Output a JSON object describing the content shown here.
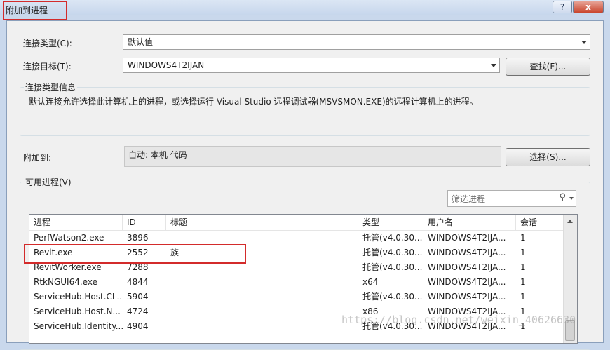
{
  "window": {
    "title": "附加到进程",
    "help_label": "?",
    "close_label": "x"
  },
  "connection": {
    "type_label": "连接类型(C):",
    "type_value": "默认值",
    "target_label": "连接目标(T):",
    "target_value": "WINDOWS4T2IJAN",
    "find_button": "查找(F)..."
  },
  "info": {
    "group_title": "连接类型信息",
    "text": "默认连接允许选择此计算机上的进程，或选择运行 Visual Studio 远程调试器(MSVSMON.EXE)的远程计算机上的进程。"
  },
  "attach": {
    "label": "附加到:",
    "value": "自动: 本机 代码",
    "select_button": "选择(S)..."
  },
  "processes": {
    "group_title": "可用进程(V)",
    "filter_placeholder": "筛选进程",
    "columns": [
      "进程",
      "ID",
      "标题",
      "类型",
      "用户名",
      "会话"
    ],
    "rows": [
      [
        "PerfWatson2.exe",
        "3896",
        "",
        "托管(v4.0.30...",
        "WINDOWS4T2IJA...",
        "1"
      ],
      [
        "Revit.exe",
        "2552",
        "族",
        "托管(v4.0.30...",
        "WINDOWS4T2IJA...",
        "1"
      ],
      [
        "RevitWorker.exe",
        "7288",
        "",
        "托管(v4.0.30...",
        "WINDOWS4T2IJA...",
        "1"
      ],
      [
        "RtkNGUI64.exe",
        "4844",
        "",
        "x64",
        "WINDOWS4T2IJA...",
        "1"
      ],
      [
        "ServiceHub.Host.CL...",
        "5904",
        "",
        "托管(v4.0.30...",
        "WINDOWS4T2IJA...",
        "1"
      ],
      [
        "ServiceHub.Host.N...",
        "4724",
        "",
        "x86",
        "WINDOWS4T2IJA...",
        "1"
      ],
      [
        "ServiceHub.Identity...",
        "4904",
        "",
        "托管(v4.0.30...",
        "WINDOWS4T2IJA...",
        "1"
      ]
    ]
  },
  "watermark": "https://blog.csdn.net/weixin_40626630",
  "colors": {
    "highlight_box": "#d32b2b",
    "dialog_bg": "#f0f0f0",
    "frame": "#c9d8ec"
  }
}
